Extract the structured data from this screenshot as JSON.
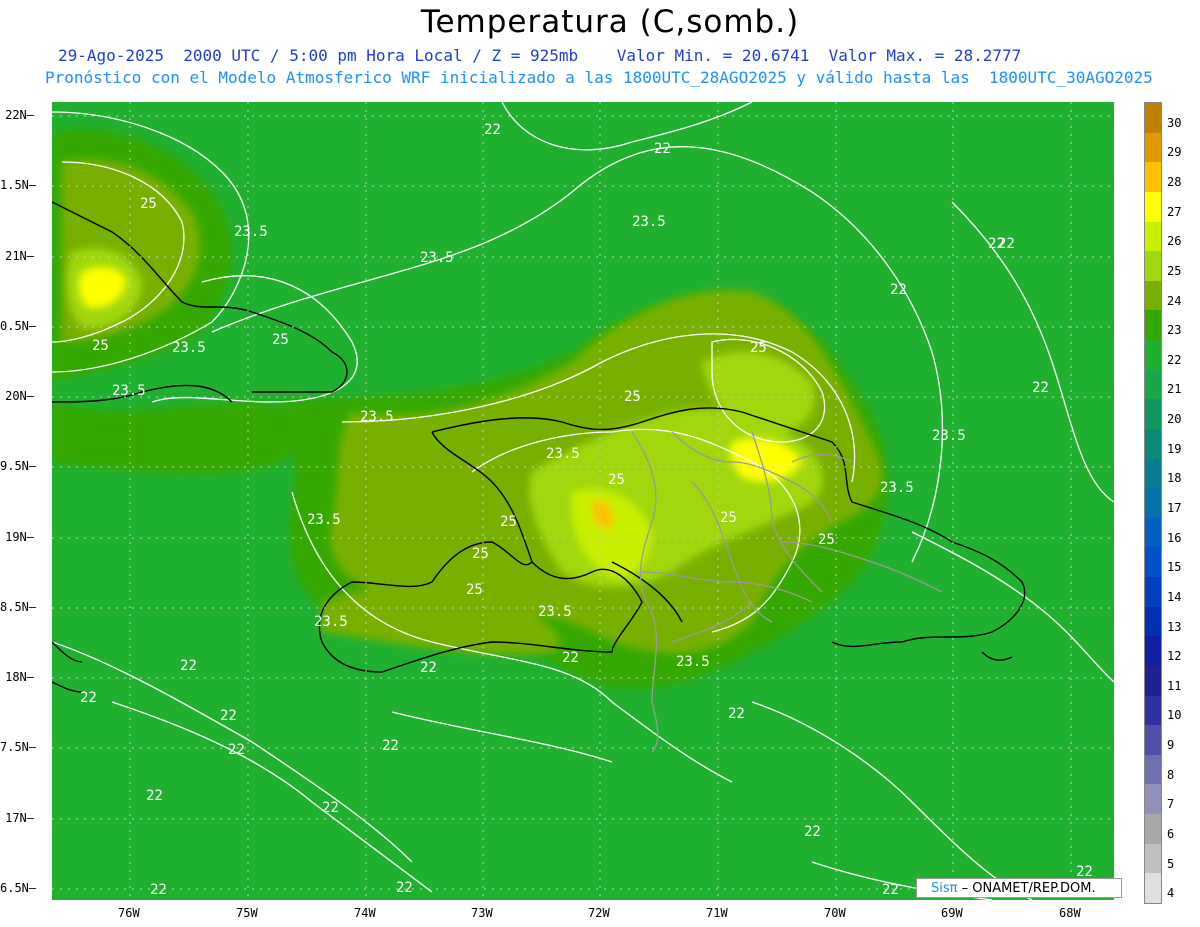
{
  "title": "Temperatura (C,somb.)",
  "subtitle1": "29-Ago-2025  2000 UTC / 5:00 pm Hora Local / Z = 925mb    Valor Min. = 20.6741  Valor Max. = 28.2777",
  "subtitle2": "Pronóstico con el Modelo Atmosferico WRF inicializado a las 1800UTC_28AGO2025 y válido hasta las  1800UTC_30AGO2025",
  "credit": {
    "logo": "Sisπ",
    "text": " – ONAMET/REP.DOM."
  },
  "y_axis": [
    "22N",
    "1.5N",
    "21N",
    "0.5N",
    "20N",
    "9.5N",
    "19N",
    "8.5N",
    "18N",
    "7.5N",
    "17N",
    "6.5N"
  ],
  "x_axis": [
    "76W",
    "75W",
    "74W",
    "73W",
    "72W",
    "71W",
    "70W",
    "69W",
    "68W"
  ],
  "colorbar": {
    "labels": [
      "30",
      "29",
      "28",
      "27",
      "26",
      "25",
      "24",
      "23",
      "22",
      "21",
      "20",
      "19",
      "18",
      "17",
      "16",
      "15",
      "14",
      "13",
      "12",
      "11",
      "10",
      "9",
      "8",
      "7",
      "6",
      "5",
      "4"
    ],
    "colors": [
      "#c08000",
      "#e09a00",
      "#ffc000",
      "#ffff00",
      "#c8f000",
      "#a0d810",
      "#78b000",
      "#34a800",
      "#20b030",
      "#18a848",
      "#109860",
      "#0a8a78",
      "#087c90",
      "#0670a8",
      "#0460c0",
      "#0350c8",
      "#0240c0",
      "#0230b0",
      "#1020a0",
      "#202090",
      "#3030a0",
      "#5050a8",
      "#7070b0",
      "#9090b8",
      "#a8a8a8",
      "#c0c0c0",
      "#e0e0e0"
    ]
  },
  "contour_labels": [
    "25",
    "23.5",
    "25",
    "22",
    "22",
    "23.5",
    "23.5",
    "25",
    "23.5",
    "25",
    "22",
    "22",
    "23.5",
    "23.5",
    "25",
    "25",
    "23.5",
    "25",
    "25",
    "25",
    "25",
    "23.5",
    "25",
    "23.5",
    "23.5",
    "23.5",
    "23.5",
    "25",
    "22",
    "22",
    "22",
    "22",
    "22",
    "23.5",
    "22",
    "22",
    "22",
    "22",
    "22",
    "22",
    "22",
    "22",
    "22",
    "22",
    "22",
    "22"
  ]
}
